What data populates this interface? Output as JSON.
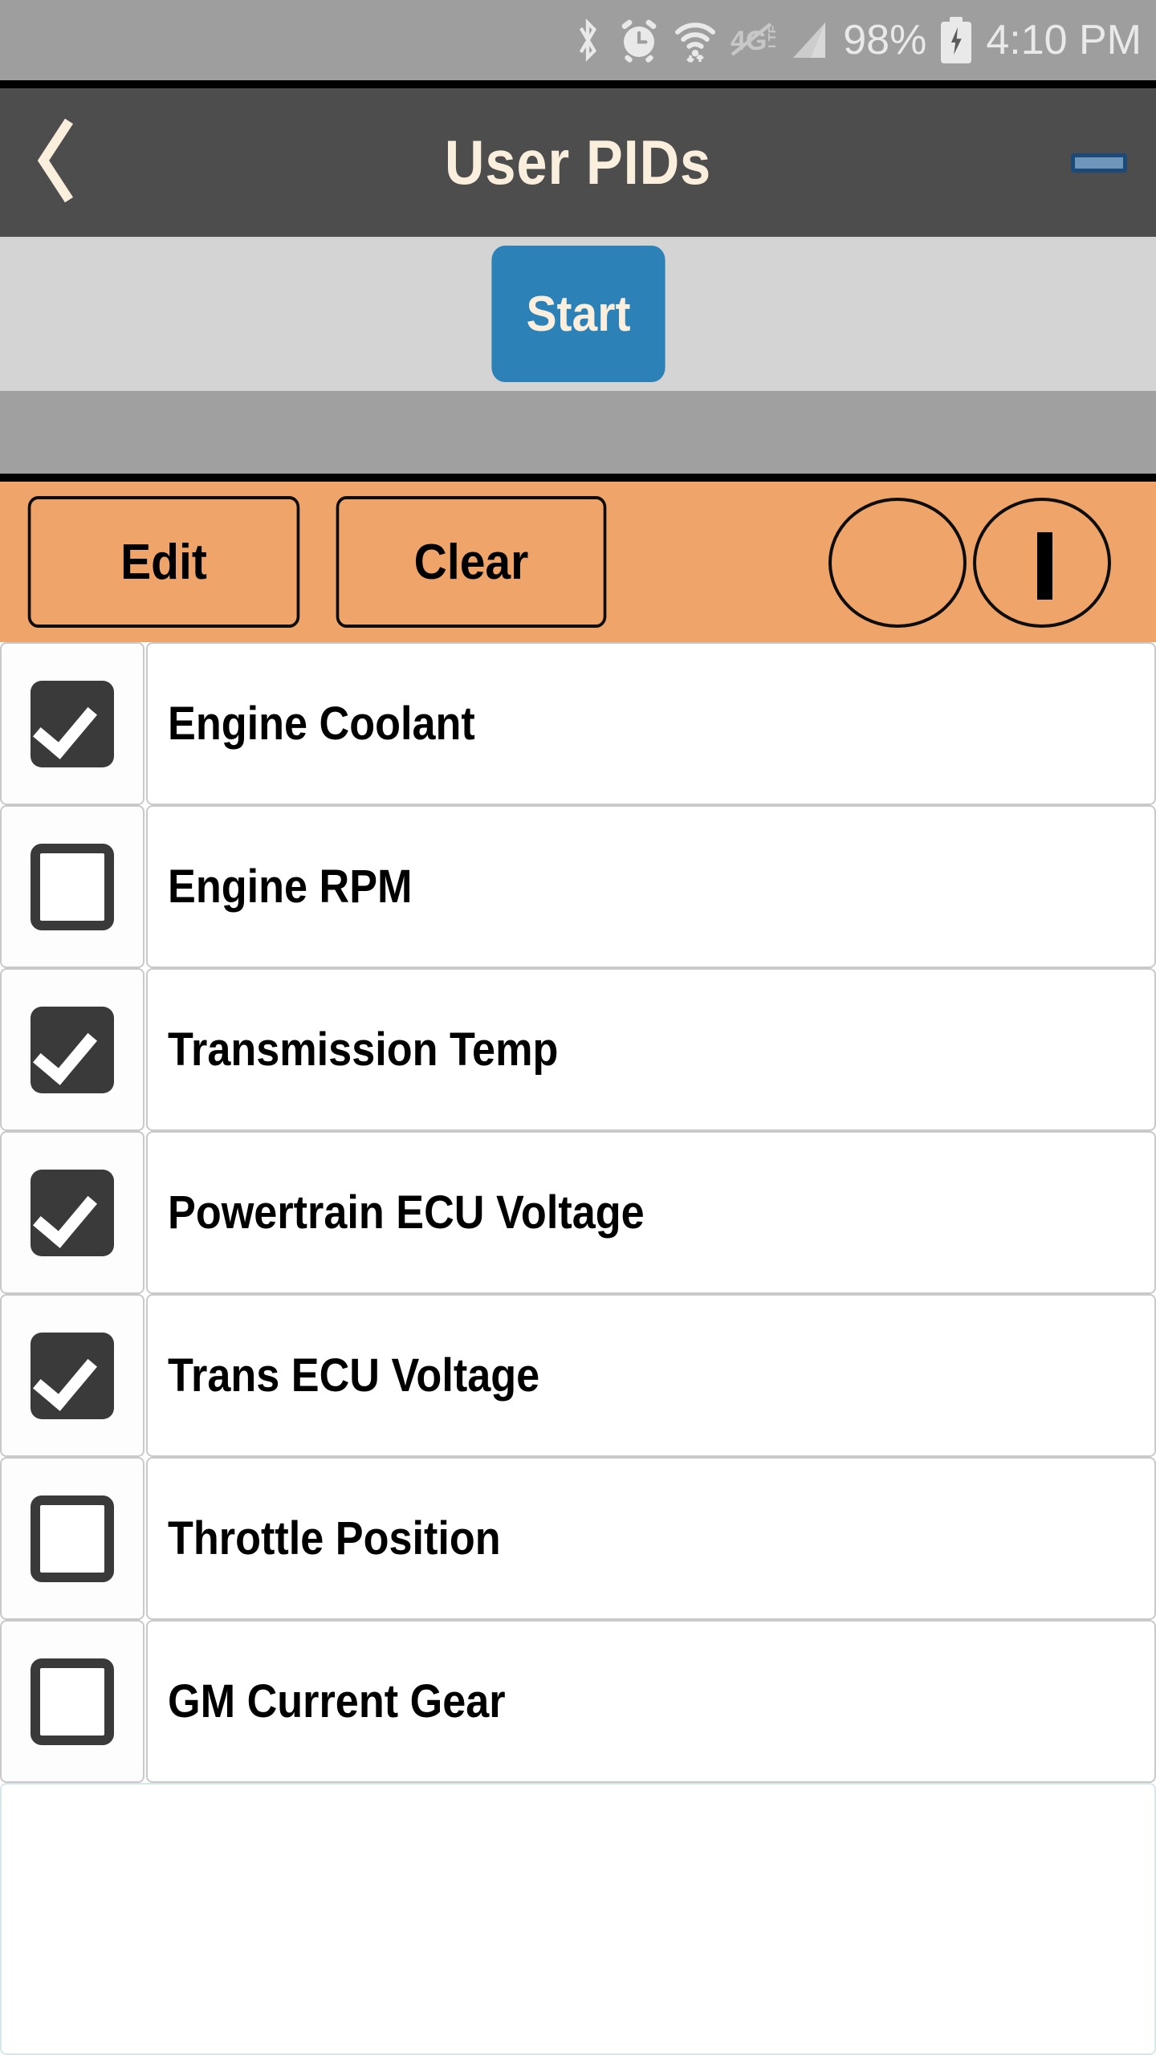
{
  "status_bar": {
    "icons": [
      "bluetooth-icon",
      "alarm-clock-icon",
      "wifi-icon",
      "mobile-data-off-icon",
      "cell-signal-icon"
    ],
    "battery_percent": "98%",
    "battery_state": "charging",
    "time": "4:10 PM"
  },
  "title_bar": {
    "back_label": "‹",
    "title": "User PIDs",
    "minimize_label": ""
  },
  "action_band": {
    "start_label": "Start"
  },
  "toolbar": {
    "edit_label": "Edit",
    "clear_label": "Clear",
    "minus_label": "−",
    "plus_label": "+"
  },
  "pid_list": {
    "items": [
      {
        "label": "Engine Coolant",
        "checked": true
      },
      {
        "label": "Engine RPM",
        "checked": false
      },
      {
        "label": "Transmission Temp",
        "checked": true
      },
      {
        "label": "Powertrain ECU Voltage",
        "checked": true
      },
      {
        "label": "Trans ECU Voltage",
        "checked": true
      },
      {
        "label": "Throttle Position",
        "checked": false
      },
      {
        "label": "GM Current Gear",
        "checked": false
      }
    ]
  },
  "colors": {
    "status_bar_bg": "#9e9e9e",
    "title_bar_bg": "#4d4d4d",
    "title_text": "#faeedd",
    "start_button_bg": "#2c81b6",
    "start_band_bg": "#d4d4d4",
    "gray_bar_bg": "#a0a0a0",
    "toolbar_bg": "#efa469",
    "checkbox_on_bg": "#3a3a3a",
    "minimize_fill": "#6e95ba",
    "minimize_border": "#1b4a79"
  }
}
